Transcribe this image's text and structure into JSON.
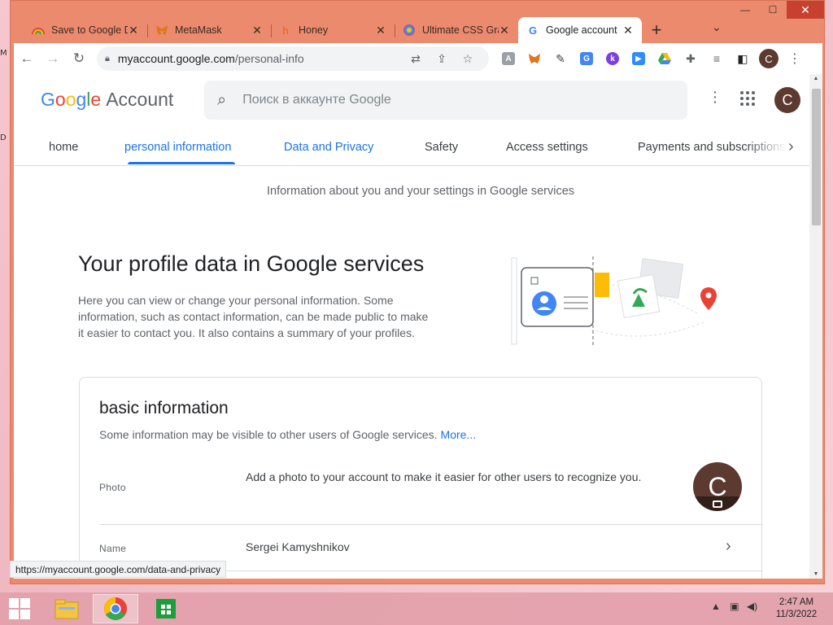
{
  "desktop": {
    "edge_labels": [
      "M",
      "D"
    ]
  },
  "browser": {
    "tabs": [
      {
        "title": "Save to Google Drive",
        "icon": "drive-rainbow-icon"
      },
      {
        "title": "MetaMask",
        "icon": "metamask-fox-icon"
      },
      {
        "title": "Honey",
        "icon": "honey-icon"
      },
      {
        "title": "Ultimate CSS Gradient Generator",
        "icon": "gradient-icon"
      },
      {
        "title": "Google account",
        "icon": "google-g-icon",
        "active": true
      }
    ],
    "new_tab": "+",
    "tab_search": "⌄",
    "window_controls": {
      "minimize": "—",
      "maximize": "☐",
      "close": "✕"
    },
    "url": {
      "host": "myaccount.google.com",
      "path": "/personal-info"
    },
    "profile_initial": "C",
    "status_url": "https://myaccount.google.com/data-and-privacy"
  },
  "account": {
    "logo": {
      "google": "Google",
      "account": "Account"
    },
    "search_placeholder": "Поиск в аккаунте Google",
    "avatar_initial": "C",
    "tabs": [
      "home",
      "personal information",
      "Data and Privacy",
      "Safety",
      "Access settings",
      "Payments and subscriptions"
    ],
    "active_tab": "personal information",
    "subtitle": "Information about you and your settings in Google services",
    "hero": {
      "title": "Your profile data in Google services",
      "text": "Here you can view or change your personal information. Some information, such as contact information, can be made public to make it easier to contact you. It also contains a summary of your profiles."
    },
    "basic_info": {
      "title": "basic information",
      "description": "Some information may be visible to other users of Google services.",
      "more_link": "More...",
      "rows": [
        {
          "label": "Photo",
          "value": "Add a photo to your account to make it easier for other users to recognize you.",
          "avatar_initial": "C"
        },
        {
          "label": "Name",
          "value": "Sergei Kamyshnikov"
        }
      ]
    }
  },
  "taskbar": {
    "clock_time": "2:47 AM",
    "clock_date": "11/3/2022"
  },
  "colors": {
    "accent": "#1a73e8",
    "chrome_frame": "#ec8a6e",
    "avatar": "#5d3a2f"
  }
}
